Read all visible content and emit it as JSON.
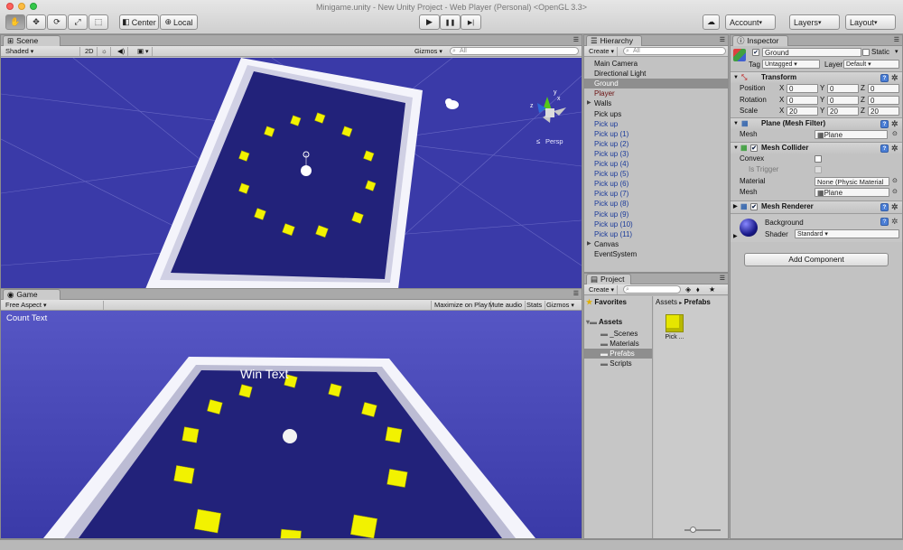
{
  "window": {
    "title": "Minigame.unity - New Unity Project - Web Player (Personal) <OpenGL 3.3>"
  },
  "toolbar": {
    "pivot": "Center",
    "space": "Local",
    "account": "Account",
    "layers": "Layers",
    "layout": "Layout",
    "play_icon": "▶",
    "pause_icon": "❚❚",
    "step_icon": "▶|",
    "cloud_icon": "☁"
  },
  "scene": {
    "tab": "Scene",
    "shading": "Shaded",
    "mode_2d": "2D",
    "gizmos": "Gizmos",
    "search_placeholder": "All",
    "persp_label": "Persp",
    "gizmo_axes": {
      "y": "y",
      "x": "x",
      "z": "z"
    }
  },
  "game": {
    "tab": "Game",
    "aspect": "Free Aspect",
    "maximize_on_play": "Maximize on Play",
    "mute_audio": "Mute audio",
    "stats": "Stats",
    "gizmos": "Gizmos",
    "count_text": "Count Text",
    "win_text": "Win Text"
  },
  "hierarchy": {
    "tab": "Hierarchy",
    "create": "Create",
    "search_placeholder": "All",
    "items": [
      {
        "label": "Main Camera",
        "type": "normal"
      },
      {
        "label": "Directional Light",
        "type": "normal"
      },
      {
        "label": "Ground",
        "type": "selected"
      },
      {
        "label": "Player",
        "type": "player"
      },
      {
        "label": "Walls",
        "type": "normal",
        "expandable": true
      },
      {
        "label": "Pick ups",
        "type": "normal"
      },
      {
        "label": "Pick up",
        "type": "prefab"
      },
      {
        "label": "Pick up (1)",
        "type": "prefab"
      },
      {
        "label": "Pick up (2)",
        "type": "prefab"
      },
      {
        "label": "Pick up (3)",
        "type": "prefab"
      },
      {
        "label": "Pick up (4)",
        "type": "prefab"
      },
      {
        "label": "Pick up (5)",
        "type": "prefab"
      },
      {
        "label": "Pick up (6)",
        "type": "prefab"
      },
      {
        "label": "Pick up (7)",
        "type": "prefab"
      },
      {
        "label": "Pick up (8)",
        "type": "prefab"
      },
      {
        "label": "Pick up (9)",
        "type": "prefab"
      },
      {
        "label": "Pick up (10)",
        "type": "prefab"
      },
      {
        "label": "Pick up (11)",
        "type": "prefab"
      },
      {
        "label": "Canvas",
        "type": "normal",
        "expandable": true
      },
      {
        "label": "EventSystem",
        "type": "normal"
      }
    ]
  },
  "project": {
    "tab": "Project",
    "create": "Create",
    "favorites": "Favorites",
    "assets": "Assets",
    "folders": [
      "_Scenes",
      "Materials",
      "Prefabs",
      "Scripts"
    ],
    "selected_folder": "Prefabs",
    "breadcrumb_root": "Assets",
    "breadcrumb_sep": "▸",
    "breadcrumb_current": "Prefabs",
    "asset_items": [
      {
        "label": "Pick ..."
      }
    ]
  },
  "inspector": {
    "tab": "Inspector",
    "object_name": "Ground",
    "static_label": "Static",
    "tag_label": "Tag",
    "tag_value": "Untagged",
    "layer_label": "Layer",
    "layer_value": "Default",
    "transform": {
      "title": "Transform",
      "position_label": "Position",
      "rotation_label": "Rotation",
      "scale_label": "Scale",
      "axis_x": "X",
      "axis_y": "Y",
      "axis_z": "Z",
      "position": [
        "0",
        "0",
        "0"
      ],
      "rotation": [
        "0",
        "0",
        "0"
      ],
      "scale": [
        "20",
        "20",
        "20"
      ]
    },
    "mesh_filter": {
      "title": "Plane (Mesh Filter)",
      "mesh_label": "Mesh",
      "mesh_value": "Plane"
    },
    "mesh_collider": {
      "title": "Mesh Collider",
      "convex_label": "Convex",
      "trigger_label": "Is Trigger",
      "material_label": "Material",
      "material_value": "None (Physic Material",
      "mesh_label": "Mesh",
      "mesh_value": "Plane"
    },
    "mesh_renderer": {
      "title": "Mesh Renderer"
    },
    "material": {
      "name": "Background",
      "shader_label": "Shader",
      "shader_value": "Standard"
    },
    "add_component": "Add Component"
  },
  "colors": {
    "scene_bg": "#3a3aa8",
    "game_bg": "#4848b8",
    "floor": "#22227a",
    "wall": "#f2f2f8",
    "pickup": "#f2f200",
    "selection": "#8e8e8e",
    "prefab_text": "#1a3a9a"
  }
}
